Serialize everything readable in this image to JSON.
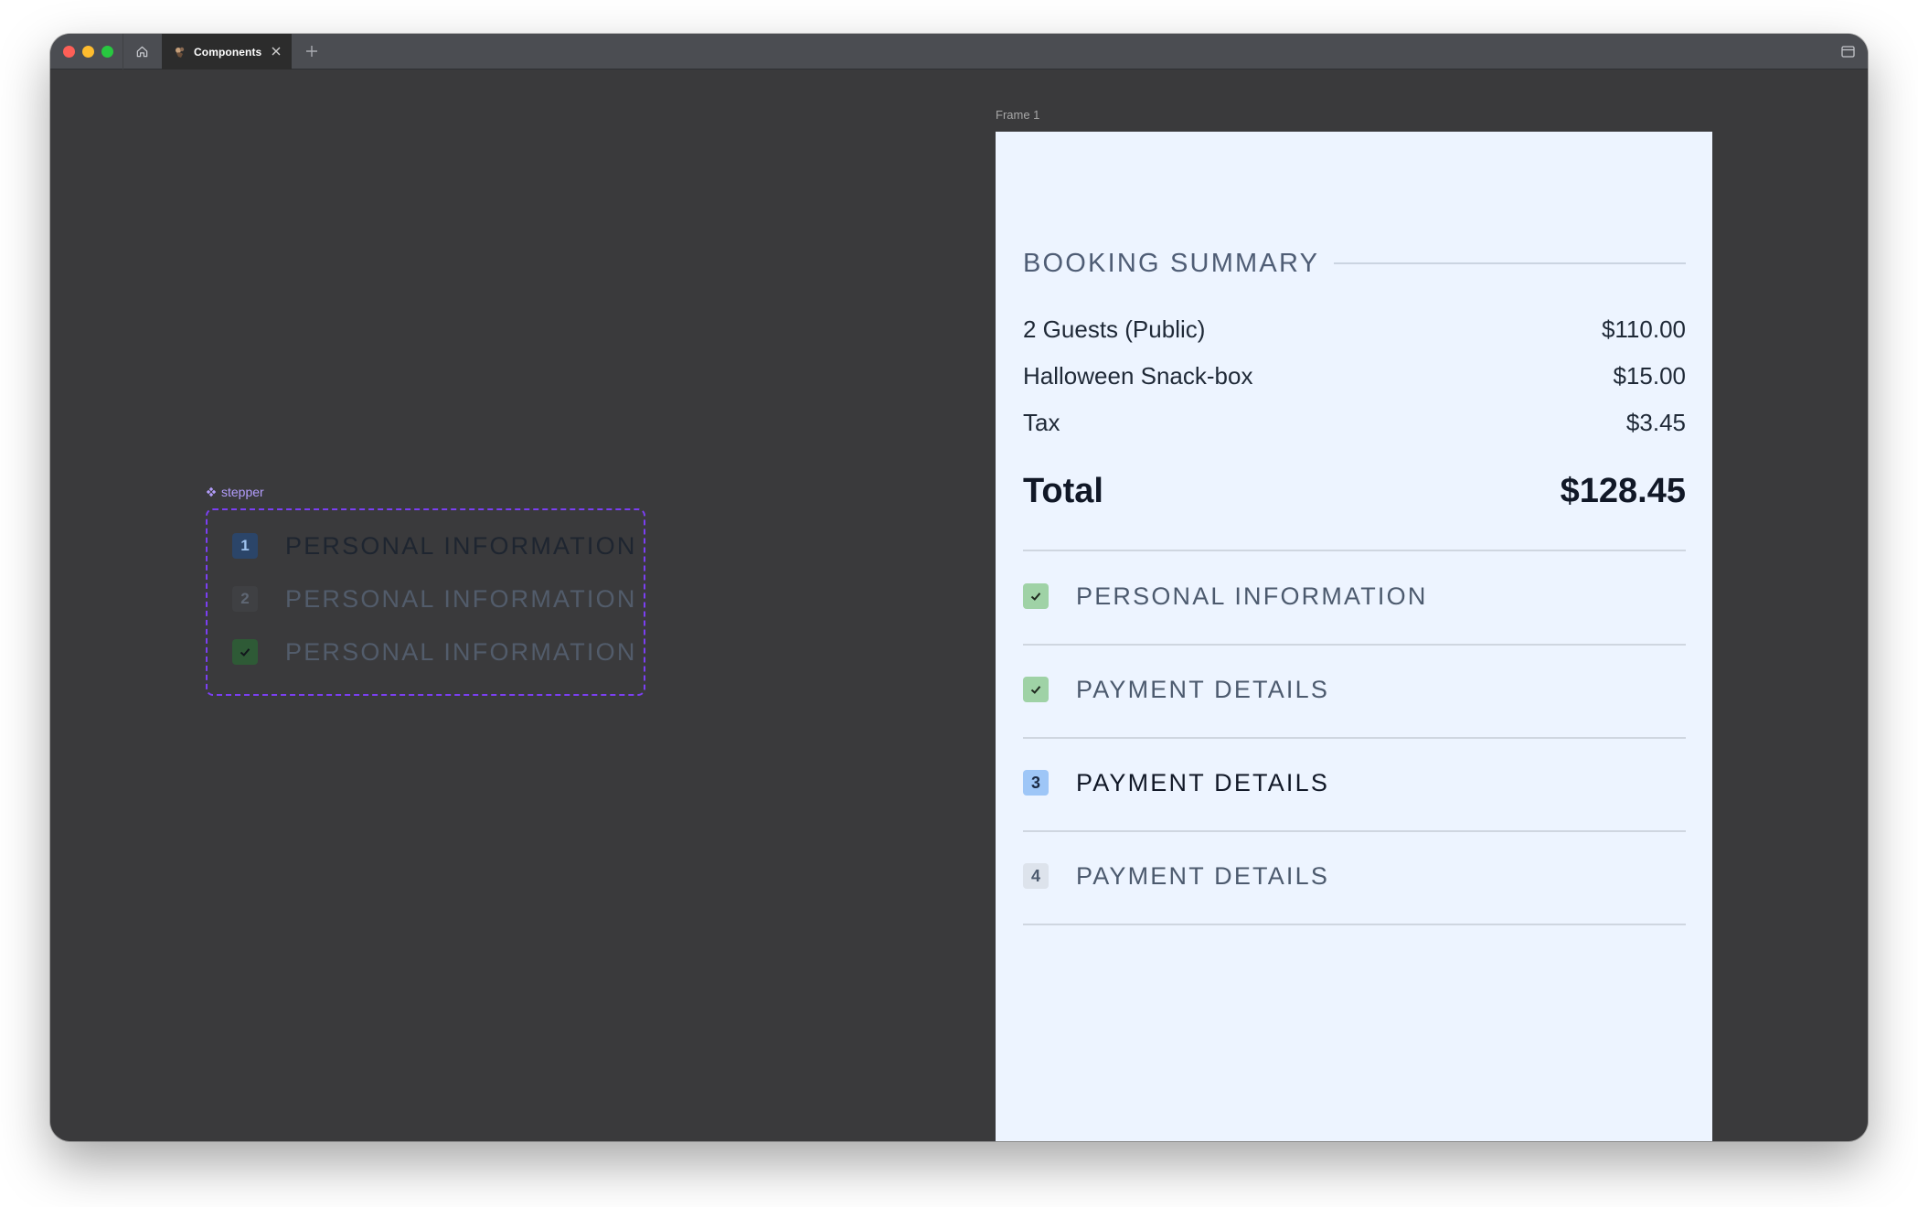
{
  "tab": {
    "title": "Components"
  },
  "canvas": {
    "component_label": "stepper",
    "stepper_items": [
      {
        "badge": "1",
        "label": "PERSONAL INFORMATION",
        "state": "current"
      },
      {
        "badge": "2",
        "label": "PERSONAL INFORMATION",
        "state": "upcoming"
      },
      {
        "badge": "",
        "label": "PERSONAL INFORMATION",
        "state": "done"
      }
    ]
  },
  "frame": {
    "label": "Frame 1",
    "summary_title": "BOOKING SUMMARY",
    "line_items": [
      {
        "name": "2 Guests (Public)",
        "price": "$110.00"
      },
      {
        "name": "Halloween Snack-box",
        "price": "$15.00"
      },
      {
        "name": "Tax",
        "price": "$3.45"
      }
    ],
    "total": {
      "label": "Total",
      "amount": "$128.45"
    },
    "steps": [
      {
        "badge": "",
        "label": "PERSONAL INFORMATION",
        "state": "done"
      },
      {
        "badge": "",
        "label": "PAYMENT DETAILS",
        "state": "done"
      },
      {
        "badge": "3",
        "label": "PAYMENT DETAILS",
        "state": "current"
      },
      {
        "badge": "4",
        "label": "PAYMENT DETAILS",
        "state": "upcoming"
      }
    ]
  },
  "colors": {
    "canvas_bg": "#3a3a3c",
    "frame_bg": "#edf4ff",
    "done_badge": "#9fd2a6",
    "current_badge": "#9ec6f7",
    "upcoming_badge": "#dde3ec",
    "selection_outline": "#7b3ff2"
  }
}
